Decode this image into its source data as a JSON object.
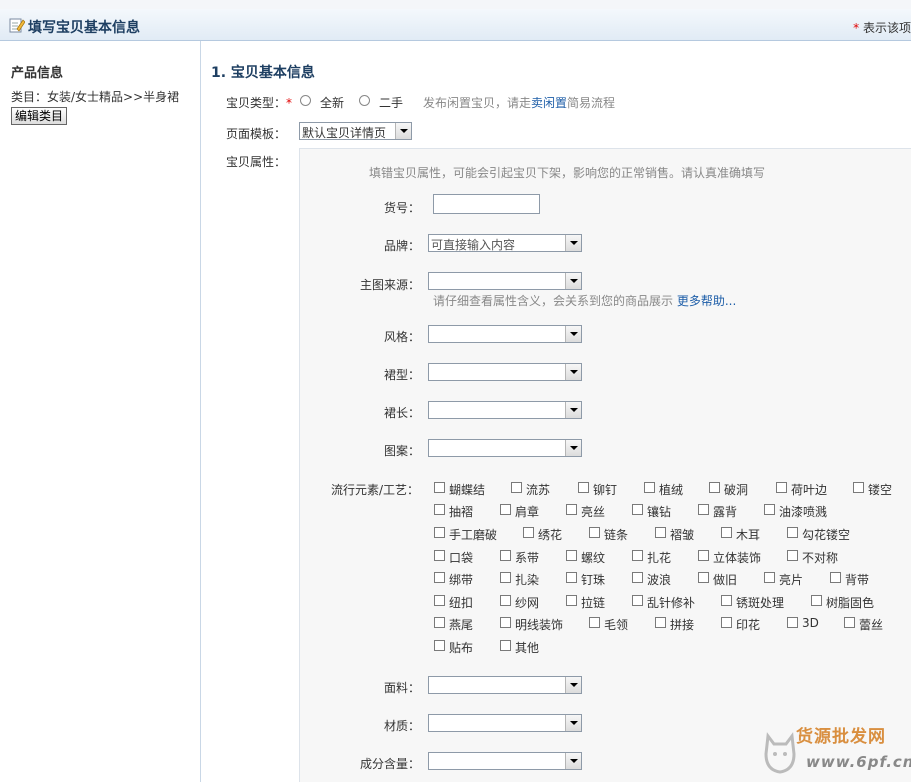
{
  "header": {
    "title": "填写宝贝基本信息",
    "required_note": "表示该项",
    "required_star": "*"
  },
  "sidebar": {
    "title": "产品信息",
    "category": "类目：女装/女士精品>>半身裙",
    "edit_button": "编辑类目"
  },
  "main": {
    "section_title": "1. 宝贝基本信息",
    "type_label": "宝贝类型：",
    "type_star": "*",
    "type_options": [
      "全新",
      "二手"
    ],
    "type_hint_prefix": "发布闲置宝贝，请走",
    "type_hint_link": "卖闲置",
    "type_hint_suffix": "简易流程",
    "template_label": "页面模板：",
    "template_value": "默认宝贝详情页",
    "attr_label": "宝贝属性："
  },
  "attrs": {
    "hint": "填错宝贝属性，可能会引起宝贝下架，影响您的正常销售。请认真准确填写",
    "huohao_label": "货号：",
    "brand_label": "品牌：",
    "brand_placeholder": "可直接输入内容",
    "source_label": "主图来源：",
    "source_hint": "请仔细查看属性含义，会关系到您的商品展示",
    "source_help": "更多帮助...",
    "style_label": "风格：",
    "skirt_type_label": "裙型：",
    "skirt_length_label": "裙长：",
    "pattern_label": "图案：",
    "elements_label": "流行元素/工艺：",
    "fabric_label": "面料：",
    "material_label": "材质：",
    "composition_label": "成分含量："
  },
  "elements": [
    [
      "蝴蝶结",
      "流苏",
      "铆钉",
      "植绒",
      "破洞",
      "荷叶边",
      "镂空"
    ],
    [
      "抽褶",
      "肩章",
      "亮丝",
      "镶钻",
      "露背",
      "油漆喷溅"
    ],
    [
      "手工磨破",
      "绣花",
      "链条",
      "褶皱",
      "木耳",
      "勾花镂空"
    ],
    [
      "口袋",
      "系带",
      "螺纹",
      "扎花",
      "立体装饰",
      "不对称"
    ],
    [
      "绑带",
      "扎染",
      "钉珠",
      "波浪",
      "做旧",
      "亮片",
      "背带"
    ],
    [
      "纽扣",
      "纱网",
      "拉链",
      "乱针修补",
      "锈斑处理",
      "树脂固色"
    ],
    [
      "燕尾",
      "明线装饰",
      "毛领",
      "拼接",
      "印花",
      "3D",
      "蕾丝"
    ],
    [
      "贴布",
      "其他"
    ]
  ],
  "watermark": {
    "text": "货源批发网",
    "url": "www.6pf.cn"
  },
  "icons": {
    "header_icon": "edit-note-icon"
  }
}
